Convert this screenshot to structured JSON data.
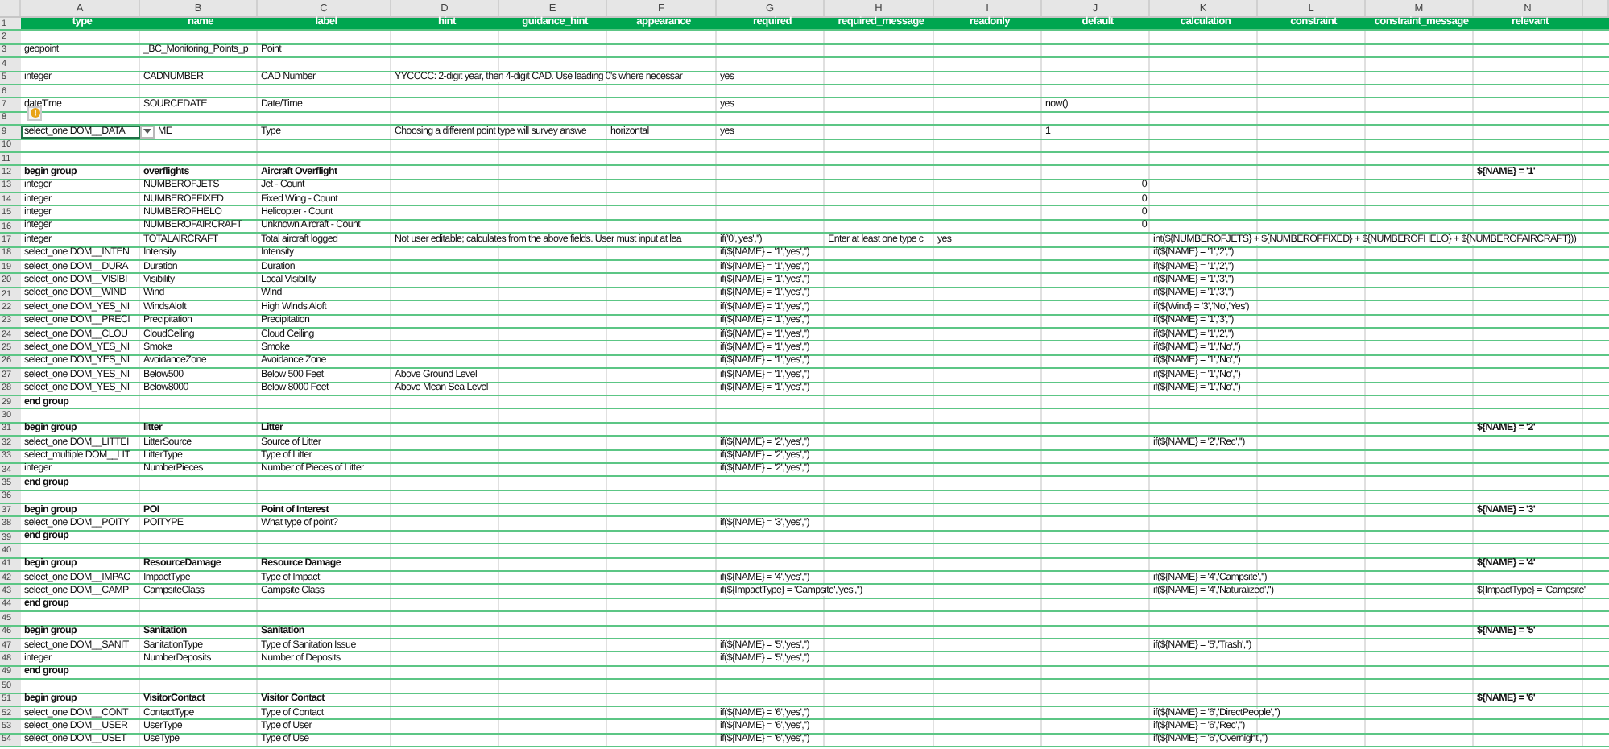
{
  "columns": [
    "A",
    "B",
    "C",
    "D",
    "E",
    "F",
    "G",
    "H",
    "I",
    "J",
    "K",
    "L",
    "M",
    "N"
  ],
  "rows": [
    {
      "number": "1",
      "kind": "header",
      "cells": {
        "A": "type",
        "B": "name",
        "C": "label",
        "D": "hint",
        "E": "guidance_hint",
        "F": "appearance",
        "G": "required",
        "H": "required_message",
        "I": "readonly",
        "J": "default",
        "K": "calculation",
        "L": "constraint",
        "M": "constraint_message",
        "N": "relevant"
      }
    },
    {
      "number": "2",
      "kind": "field"
    },
    {
      "number": "3",
      "kind": "field",
      "cells": {
        "A": "geopoint",
        "B": "_BC_Monitoring_Points_p",
        "C": "Point"
      }
    },
    {
      "number": "4",
      "kind": "field"
    },
    {
      "number": "5",
      "kind": "field",
      "cells": {
        "A": "integer",
        "B": "CADNUMBER",
        "C": "CAD Number",
        "D": "YYCCCC: 2-digit year, then 4-digit CAD. Use leading 0's where necessar",
        "G": "yes"
      }
    },
    {
      "number": "6",
      "kind": "field"
    },
    {
      "number": "7",
      "kind": "field",
      "cells": {
        "A": "dateTime",
        "B": "SOURCEDATE",
        "C": "Date/Time",
        "G": "yes",
        "J": "now()"
      }
    },
    {
      "number": "8",
      "kind": "field",
      "warning": true
    },
    {
      "number": "9",
      "kind": "field",
      "cells": {
        "A": {
          "text": "select_one DOM__DATA",
          "selected": true
        },
        "B": "ME",
        "C": "Type",
        "D": "Choosing a different point type will survey answe",
        "F": "horizontal",
        "G": "yes",
        "J": "1"
      }
    },
    {
      "number": "10",
      "kind": "field"
    },
    {
      "number": "11",
      "kind": "field"
    },
    {
      "number": "12",
      "kind": "group",
      "cells": {
        "A": "begin group",
        "B": "overflights",
        "C": "Aircraft Overflight",
        "N": "${NAME} = '1'"
      }
    },
    {
      "number": "13",
      "kind": "field",
      "cells": {
        "A": "integer",
        "B": "NUMBEROFJETS",
        "C": "Jet - Count",
        "J": {
          "text": "0",
          "kind": "number"
        }
      }
    },
    {
      "number": "14",
      "kind": "field",
      "cells": {
        "A": "integer",
        "B": "NUMBEROFFIXED",
        "C": "Fixed Wing - Count",
        "J": {
          "text": "0",
          "kind": "number"
        }
      }
    },
    {
      "number": "15",
      "kind": "field",
      "cells": {
        "A": "integer",
        "B": "NUMBEROFHELO",
        "C": "Helicopter - Count",
        "J": {
          "text": "0",
          "kind": "number"
        }
      }
    },
    {
      "number": "16",
      "kind": "field",
      "cells": {
        "A": "integer",
        "B": "NUMBEROFAIRCRAFT",
        "C": "Unknown Aircraft - Count",
        "J": {
          "text": "0",
          "kind": "number"
        }
      }
    },
    {
      "number": "17",
      "kind": "field",
      "cells": {
        "A": "integer",
        "B": "TOTALAIRCRAFT",
        "C": "Total aircraft logged",
        "D": "Not user editable; calculates from the above fields. User must input at lea",
        "G": "if('0','yes','')",
        "H": "Enter at least one type c",
        "I": "yes",
        "K": "int(${NUMBEROFJETS} + ${NUMBEROFFIXED} + ${NUMBEROFHELO} + ${NUMBEROFAIRCRAFT}))"
      }
    },
    {
      "number": "18",
      "kind": "field",
      "cells": {
        "A": "select_one DOM__INTEN",
        "B": "Intensity",
        "C": "Intensity",
        "G": "if(${NAME} = '1','yes','')",
        "K": "if(${NAME} = '1','2','')"
      }
    },
    {
      "number": "19",
      "kind": "field",
      "cells": {
        "A": "select_one DOM__DURA",
        "B": "Duration",
        "C": "Duration",
        "G": "if(${NAME} = '1','yes','')",
        "K": "if(${NAME} = '1','2','')"
      }
    },
    {
      "number": "20",
      "kind": "field",
      "cells": {
        "A": "select_one DOM__VISIBI",
        "B": "Visibility",
        "C": "Local Visibility",
        "G": "if(${NAME} = '1','yes','')",
        "K": "if(${NAME} = '1','3','')"
      }
    },
    {
      "number": "21",
      "kind": "field",
      "cells": {
        "A": "select_one DOM__WIND",
        "B": "Wind",
        "C": "Wind",
        "G": "if(${NAME} = '1','yes','')",
        "K": "if(${NAME} = '1','3','')"
      }
    },
    {
      "number": "22",
      "kind": "field",
      "cells": {
        "A": "select_one DOM_YES_NI",
        "B": "WindsAloft",
        "C": "High Winds Aloft",
        "G": "if(${NAME} = '1','yes','')",
        "K": "if(${Wind} = '3','No','Yes')"
      }
    },
    {
      "number": "23",
      "kind": "field",
      "cells": {
        "A": "select_one DOM__PRECI",
        "B": "Precipitation",
        "C": "Precipitation",
        "G": "if(${NAME} = '1','yes','')",
        "K": "if(${NAME} = '1','3','')"
      }
    },
    {
      "number": "24",
      "kind": "field",
      "cells": {
        "A": "select_one DOM__CLOU",
        "B": "CloudCeiling",
        "C": "Cloud Ceiling",
        "G": "if(${NAME} = '1','yes','')",
        "K": "if(${NAME} = '1','2','')"
      }
    },
    {
      "number": "25",
      "kind": "field",
      "cells": {
        "A": "select_one DOM_YES_NI",
        "B": "Smoke",
        "C": "Smoke",
        "G": "if(${NAME} = '1','yes','')",
        "K": "if(${NAME} = '1','No','')"
      }
    },
    {
      "number": "26",
      "kind": "field",
      "cells": {
        "A": "select_one DOM_YES_NI",
        "B": "AvoidanceZone",
        "C": "Avoidance Zone",
        "G": "if(${NAME} = '1','yes','')",
        "K": "if(${NAME} = '1','No','')"
      }
    },
    {
      "number": "27",
      "kind": "field",
      "cells": {
        "A": "select_one DOM_YES_NI",
        "B": "Below500",
        "C": "Below 500 Feet",
        "D": "Above Ground Level",
        "G": "if(${NAME} = '1','yes','')",
        "K": "if(${NAME} = '1','No','')"
      }
    },
    {
      "number": "28",
      "kind": "field",
      "cells": {
        "A": "select_one DOM_YES_NI",
        "B": "Below8000",
        "C": "Below 8000 Feet",
        "D": "Above Mean Sea Level",
        "G": "if(${NAME} = '1','yes','')",
        "K": "if(${NAME} = '1','No','')"
      }
    },
    {
      "number": "29",
      "kind": "group",
      "cells": {
        "A": "end group"
      }
    },
    {
      "number": "30",
      "kind": "field"
    },
    {
      "number": "31",
      "kind": "group",
      "cells": {
        "A": "begin group",
        "B": "litter",
        "C": "Litter",
        "N": "${NAME} = '2'"
      }
    },
    {
      "number": "32",
      "kind": "field",
      "cells": {
        "A": "select_one DOM__LITTEI",
        "B": "LitterSource",
        "C": "Source of Litter",
        "G": "if(${NAME} = '2','yes','')",
        "K": "if(${NAME} = '2','Rec','')"
      }
    },
    {
      "number": "33",
      "kind": "field",
      "cells": {
        "A": "select_multiple DOM__LIT",
        "B": "LitterType",
        "C": "Type of Litter",
        "G": "if(${NAME} = '2','yes','')"
      }
    },
    {
      "number": "34",
      "kind": "field",
      "cells": {
        "A": "integer",
        "B": "NumberPieces",
        "C": "Number of Pieces of Litter",
        "G": "if(${NAME} = '2','yes','')"
      }
    },
    {
      "number": "35",
      "kind": "group",
      "cells": {
        "A": "end group"
      }
    },
    {
      "number": "36",
      "kind": "field"
    },
    {
      "number": "37",
      "kind": "group",
      "cells": {
        "A": "begin group",
        "B": "POI",
        "C": "Point of Interest",
        "N": "${NAME} = '3'"
      }
    },
    {
      "number": "38",
      "kind": "field",
      "cells": {
        "A": "select_one DOM__POITY",
        "B": "POITYPE",
        "C": "What type of point?",
        "G": "if(${NAME} = '3','yes','')"
      }
    },
    {
      "number": "39",
      "kind": "group",
      "cells": {
        "A": "end group"
      }
    },
    {
      "number": "40",
      "kind": "field"
    },
    {
      "number": "41",
      "kind": "group",
      "cells": {
        "A": "begin group",
        "B": "ResourceDamage",
        "C": "Resource Damage",
        "N": "${NAME} = '4'"
      }
    },
    {
      "number": "42",
      "kind": "field",
      "cells": {
        "A": "select_one DOM__IMPAC",
        "B": "ImpactType",
        "C": "Type of Impact",
        "G": "if(${NAME} = '4','yes','')",
        "K": "if(${NAME} = '4','Campsite','')"
      }
    },
    {
      "number": "43",
      "kind": "field",
      "cells": {
        "A": "select_one DOM__CAMP",
        "B": "CampsiteClass",
        "C": "Campsite Class",
        "G": "if(${ImpactType} = 'Campsite','yes','')",
        "K": "if(${NAME} = '4','Naturalized','')",
        "N": "${ImpactType} = 'Campsite'"
      }
    },
    {
      "number": "44",
      "kind": "group",
      "cells": {
        "A": "end group"
      }
    },
    {
      "number": "45",
      "kind": "field"
    },
    {
      "number": "46",
      "kind": "group",
      "cells": {
        "A": "begin group",
        "B": "Sanitation",
        "C": "Sanitation",
        "N": "${NAME} = '5'"
      }
    },
    {
      "number": "47",
      "kind": "field",
      "cells": {
        "A": "select_one DOM__SANIT",
        "B": "SanitationType",
        "C": "Type of Sanitation Issue",
        "G": "if(${NAME} = '5','yes','')",
        "K": "if(${NAME} = '5','Trash','')"
      }
    },
    {
      "number": "48",
      "kind": "field",
      "cells": {
        "A": "integer",
        "B": "NumberDeposits",
        "C": "Number of Deposits",
        "G": "if(${NAME} = '5','yes','')"
      }
    },
    {
      "number": "49",
      "kind": "group",
      "cells": {
        "A": "end group"
      }
    },
    {
      "number": "50",
      "kind": "field"
    },
    {
      "number": "51",
      "kind": "group",
      "cells": {
        "A": "begin group",
        "B": "VisitorContact",
        "C": "Visitor Contact",
        "N": "${NAME} = '6'"
      }
    },
    {
      "number": "52",
      "kind": "field",
      "cells": {
        "A": "select_one DOM__CONT",
        "B": "ContactType",
        "C": "Type of Contact",
        "G": "if(${NAME} = '6','yes','')",
        "K": "if(${NAME} = '6','DirectPeople','')"
      }
    },
    {
      "number": "53",
      "kind": "field",
      "cells": {
        "A": "select_one DOM__USER",
        "B": "UserType",
        "C": "Type of User",
        "G": "if(${NAME} = '6','yes','')",
        "K": "if(${NAME} = '6','Rec','')"
      }
    },
    {
      "number": "54",
      "kind": "field",
      "cells": {
        "A": "select_one DOM__USET",
        "B": "UseType",
        "C": "Type of Use",
        "G": "if(${NAME} = '6','yes','')",
        "K": "if(${NAME} = '6','Overnight','')"
      }
    }
  ]
}
